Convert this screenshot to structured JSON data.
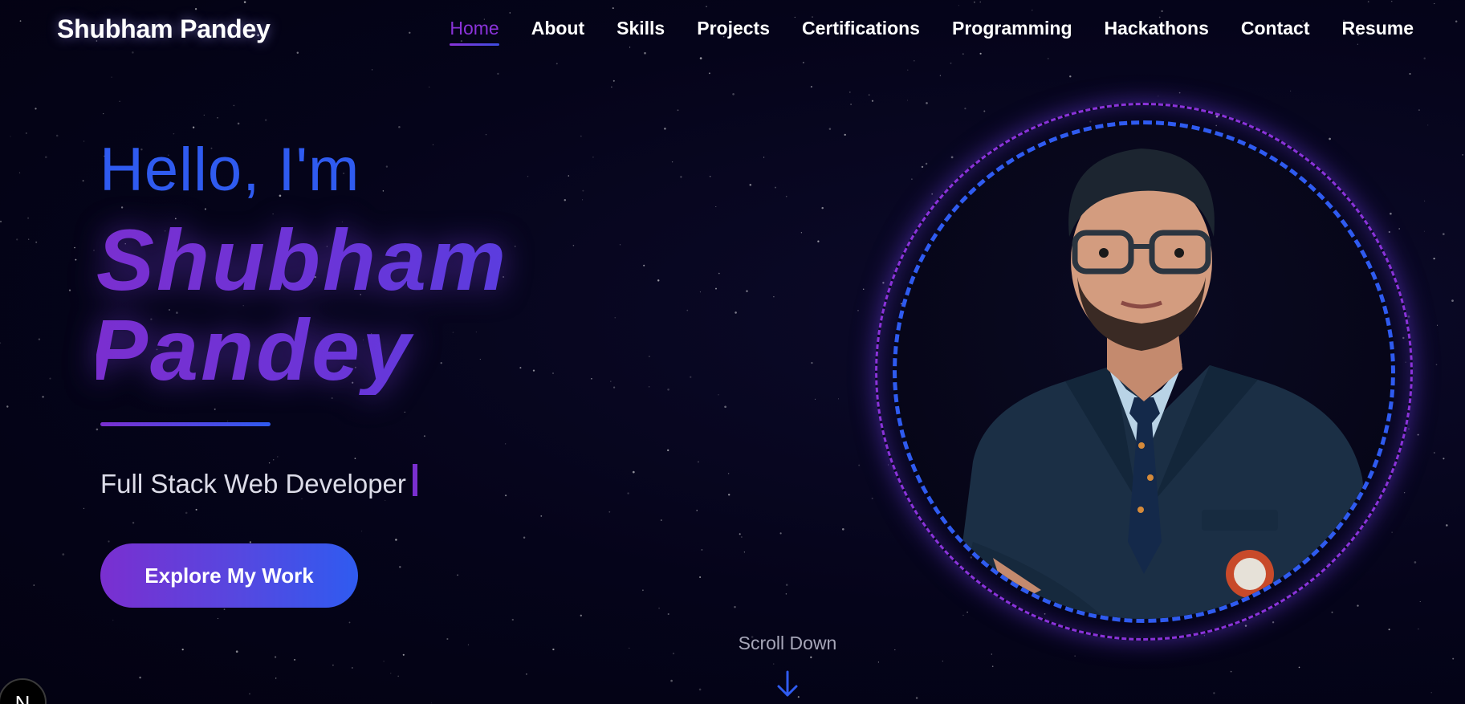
{
  "header": {
    "brand": "Shubham Pandey",
    "nav": [
      "Home",
      "About",
      "Skills",
      "Projects",
      "Certifications",
      "Programming",
      "Hackathons",
      "Contact",
      "Resume"
    ],
    "active": "Home"
  },
  "hero": {
    "greeting": "Hello, I'm",
    "name_first": "Shubham",
    "name_last": "Pandey",
    "role": "Full Stack Web Developer",
    "cta_label": "Explore My Work"
  },
  "scroll": {
    "label": "Scroll Down"
  },
  "badge": {
    "label": "N"
  },
  "colors": {
    "background": "#05041a",
    "accent_purple": "#7a2fd0",
    "accent_blue": "#2f5bf0",
    "text_primary": "#ffffff",
    "text_muted": "#a6a6b8"
  },
  "icons": {
    "scroll": "arrow-down-icon",
    "badge": "nextjs-logo-icon"
  }
}
